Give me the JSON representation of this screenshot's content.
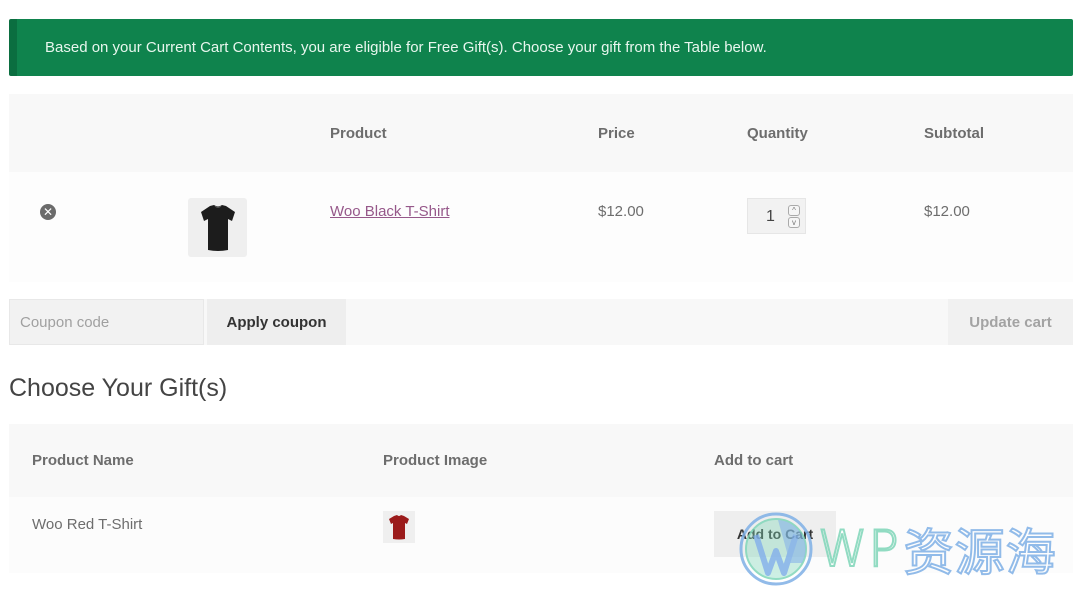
{
  "notice": {
    "message": "Based on your Current Cart Contents, you are eligible for Free Gift(s). Choose your gift from the Table below.",
    "color": "#0f834d"
  },
  "cart": {
    "headers": {
      "product": "Product",
      "price": "Price",
      "quantity": "Quantity",
      "subtotal": "Subtotal"
    },
    "items": [
      {
        "remove_icon": "remove-circle-icon",
        "remove_glyph": "✕",
        "image": "black-tshirt-thumbnail",
        "name": "Woo Black T-Shirt",
        "price": "$12.00",
        "quantity": "1",
        "subtotal": "$12.00"
      }
    ],
    "spin_up": "^",
    "spin_down": "v"
  },
  "actions": {
    "coupon_placeholder": "Coupon code",
    "apply_coupon": "Apply coupon",
    "update_cart": "Update cart"
  },
  "gifts": {
    "heading": "Choose Your Gift(s)",
    "headers": {
      "name": "Product Name",
      "image": "Product Image",
      "add": "Add to cart"
    },
    "items": [
      {
        "name": "Woo Red T-Shirt",
        "image": "red-tshirt-thumbnail",
        "button": "Add to Cart"
      }
    ]
  },
  "watermark": {
    "latin": "WP",
    "cjk": "资源海"
  },
  "colors": {
    "link": "#96588a",
    "notice_bg": "#0f834d",
    "notice_border": "#0b6e40"
  }
}
